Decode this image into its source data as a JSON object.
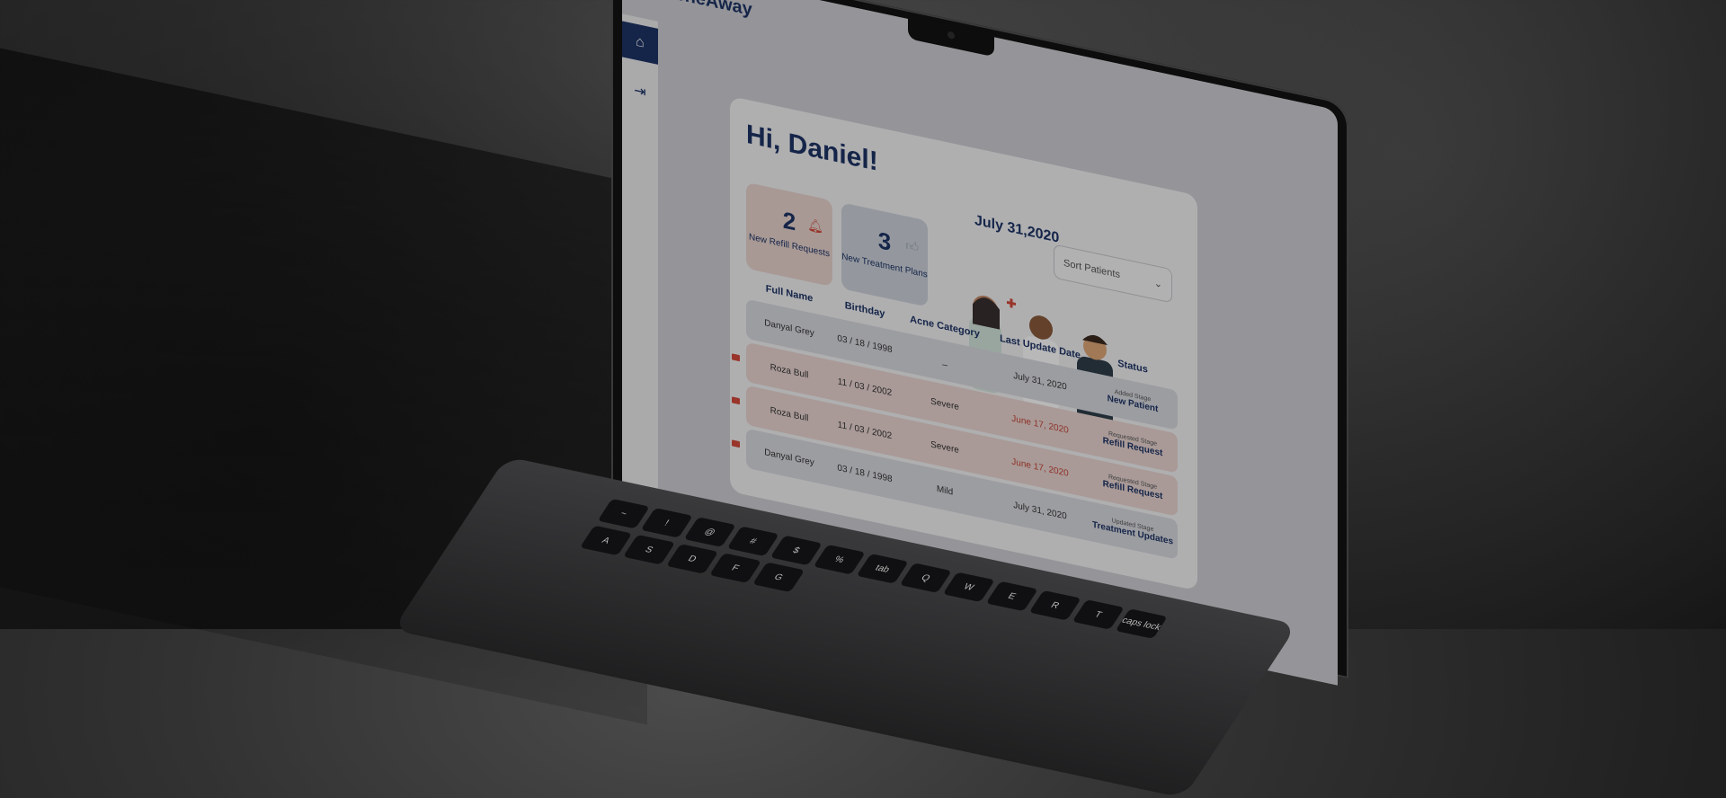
{
  "app": {
    "name": "AcneAway"
  },
  "nav": {
    "home_icon": "home-icon",
    "logout_icon": "logout-icon"
  },
  "header": {
    "greeting": "Hi, Daniel!",
    "date": "July 31,2020"
  },
  "sort": {
    "label": "Sort Patients",
    "icon": "chevron-down-icon"
  },
  "stats": {
    "refill": {
      "count": "2",
      "label": "New Refill Requests",
      "icon": "bell-icon"
    },
    "treatment": {
      "count": "3",
      "label": "New Treatment Plans",
      "icon": "thumbs-up-icon"
    }
  },
  "table": {
    "columns": [
      "Full Name",
      "Birthday",
      "Acne Category",
      "Last Update Date",
      "Status"
    ],
    "rows": [
      {
        "name": "Danyal Grey",
        "birthday": "03 / 18 / 1998",
        "category": "_",
        "date": "July 31, 2020",
        "status_sub": "Added Stage",
        "status": "New Patient"
      },
      {
        "name": "Roza Bull",
        "birthday": "11 / 03 / 2002",
        "category": "Severe",
        "date": "June 17, 2020",
        "status_sub": "Requested Stage",
        "status": "Refill Request"
      },
      {
        "name": "Roza Bull",
        "birthday": "11 / 03 / 2002",
        "category": "Severe",
        "date": "June 17, 2020",
        "status_sub": "Requested Stage",
        "status": "Refill Request"
      },
      {
        "name": "Danyal Grey",
        "birthday": "03 / 18 / 1998",
        "category": "Mild",
        "date": "July 31, 2020",
        "status_sub": "Updated Stage",
        "status": "Treatment Updates"
      }
    ]
  },
  "keyboard": {
    "keys": [
      "~",
      "!",
      "@",
      "#",
      "$",
      "%",
      "tab",
      "Q",
      "W",
      "E",
      "R",
      "T",
      "caps lock",
      "A",
      "S",
      "D",
      "F",
      "G"
    ]
  },
  "colors": {
    "brand": "#1e3466",
    "alert": "#d44a3b",
    "refill_bg": "#e9d4cf",
    "treatment_bg": "#cdd3db"
  }
}
